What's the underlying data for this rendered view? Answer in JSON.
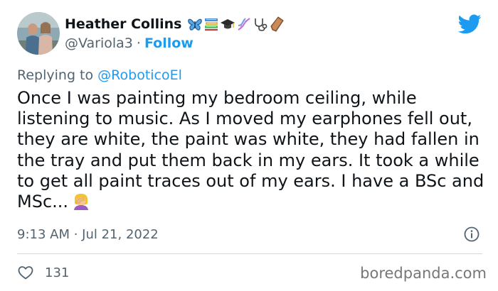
{
  "tweet": {
    "author": {
      "name": "Heather Collins",
      "name_emoji_icons": [
        "butterfly-icon",
        "books-icon",
        "graduation-cap-icon",
        "dna-icon",
        "stethoscope-icon",
        "coffin-icon"
      ],
      "handle": "@Variola3",
      "separator": "·",
      "follow_label": "Follow"
    },
    "reply": {
      "prefix": "Replying to",
      "mention": "@RoboticoEl"
    },
    "text": "Once I was painting my bedroom ceiling, while listening to music. As I moved my earphones fell out, they are white, the paint was white, they had fallen in the tray and put them back in my ears. It took a while to get all paint traces out of my ears. I have a BSc and MSc...",
    "text_emoji": "woman-facepalming-icon",
    "timestamp": "9:13 AM · Jul 21, 2022",
    "likes_count": "131"
  },
  "watermark": "boredpanda.com",
  "colors": {
    "accent": "#1d9bf0",
    "secondary_text": "#536471",
    "primary_text": "#0f1419",
    "divider": "#cfd9de"
  }
}
